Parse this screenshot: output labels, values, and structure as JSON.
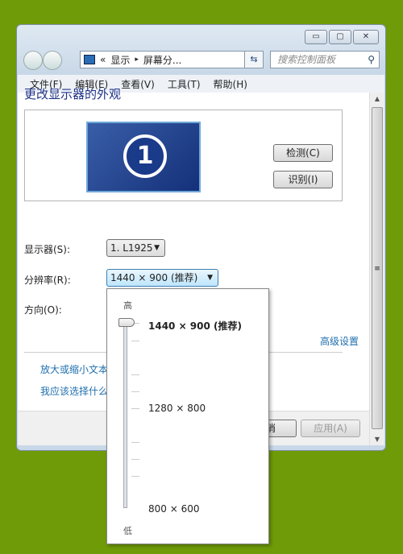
{
  "window": {
    "controls": [
      "minimize",
      "maximize",
      "close"
    ]
  },
  "address": {
    "prefix": "«",
    "crumbs": [
      "显示",
      "屏幕分..."
    ],
    "separator": "▸"
  },
  "search": {
    "placeholder": "搜索控制面板",
    "icon": "search-icon"
  },
  "menu": [
    "文件(F)",
    "编辑(E)",
    "查看(V)",
    "工具(T)",
    "帮助(H)"
  ],
  "page": {
    "title": "更改显示器的外观",
    "monitor_number": "1",
    "detect": "检测(C)",
    "identify": "识别(I)"
  },
  "form": {
    "display_label": "显示器(S):",
    "display_value": "1. L1925",
    "resolution_label": "分辨率(R):",
    "resolution_value": "1440 × 900 (推荐)",
    "orientation_label": "方向(O):"
  },
  "links": {
    "advanced": "高级设置",
    "text_size": "放大或缩小文本",
    "which": "我应该选择什么"
  },
  "footer": {
    "cancel": "取消",
    "apply": "应用(A)"
  },
  "dropdown": {
    "high": "高",
    "low": "低",
    "options": [
      "1440 × 900 (推荐)",
      "1280 × 800",
      "800 × 600"
    ],
    "selected": "1440 × 900 (推荐)",
    "slider_level": 1.0
  },
  "colors": {
    "background": "#6f9b08",
    "link": "#1f6fae",
    "title": "#1e3287"
  }
}
